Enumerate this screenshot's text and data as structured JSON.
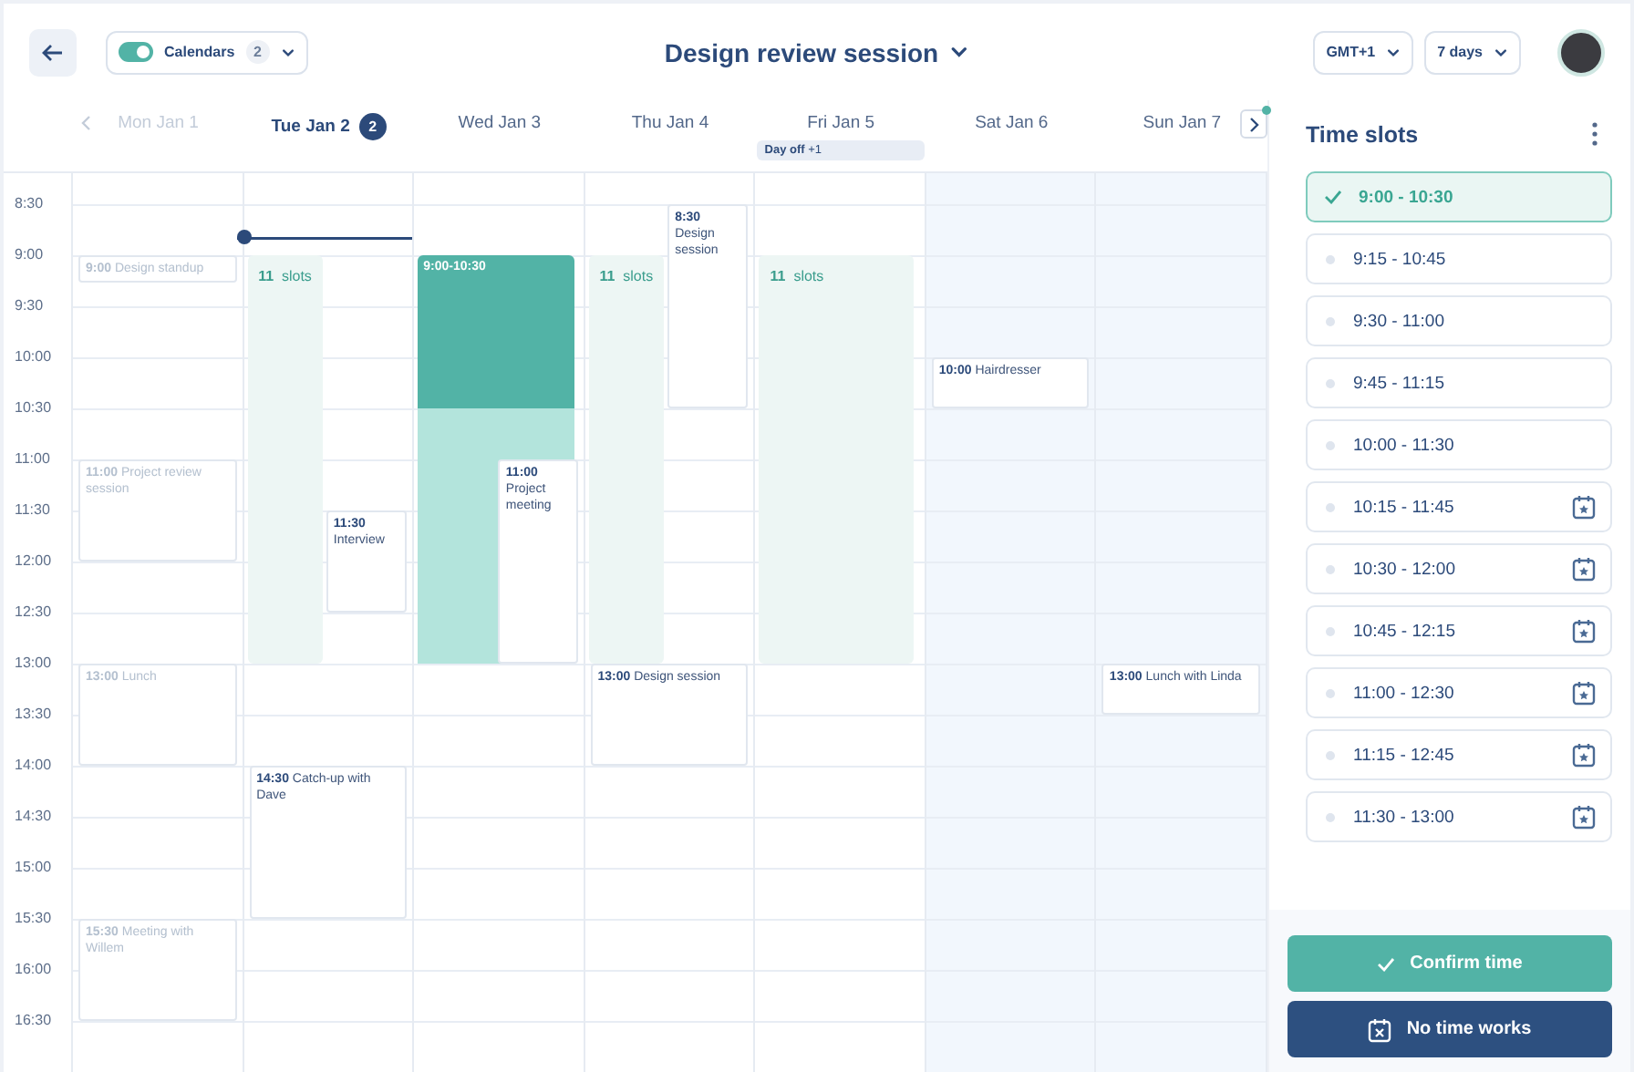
{
  "header": {
    "calendars": {
      "label": "Calendars",
      "count": "2",
      "on": true
    },
    "title": "Design review session",
    "timezone": "GMT+1",
    "range": "7 days"
  },
  "days": [
    {
      "label": "Mon Jan 1",
      "past": true,
      "selected": false,
      "weekend": false,
      "events": [
        {
          "kind": "event",
          "time": "9:00",
          "title": "Design standup"
        },
        {
          "kind": "event",
          "time": "11:00",
          "title": "Project review session"
        },
        {
          "kind": "event",
          "time": "13:00",
          "title": "Lunch"
        },
        {
          "kind": "event",
          "time": "15:30",
          "title": "Meeting with Willem"
        }
      ]
    },
    {
      "label": "Tue Jan 2",
      "badge": "2",
      "past": false,
      "selected": true,
      "weekend": false,
      "events": [
        {
          "kind": "slots",
          "count": "11",
          "label": "slots"
        },
        {
          "kind": "event",
          "time": "11:30",
          "title": "Interview"
        },
        {
          "kind": "event",
          "time": "14:30",
          "title": "Catch-up with Dave"
        }
      ]
    },
    {
      "label": "Wed Jan 3",
      "past": false,
      "selected": false,
      "weekend": false,
      "events": [
        {
          "kind": "selection",
          "label": "9:00-10:30"
        },
        {
          "kind": "event",
          "time": "11:00",
          "title": "Project meeting"
        }
      ]
    },
    {
      "label": "Thu Jan 4",
      "past": false,
      "selected": false,
      "weekend": false,
      "events": [
        {
          "kind": "slots",
          "count": "11",
          "label": "slots"
        },
        {
          "kind": "event",
          "time": "8:30",
          "title": "Design session"
        },
        {
          "kind": "event",
          "time": "13:00",
          "title": "Design session"
        }
      ]
    },
    {
      "label": "Fri Jan 5",
      "chip": {
        "label": "Day off",
        "extra": "+1"
      },
      "past": false,
      "selected": false,
      "weekend": false,
      "events": [
        {
          "kind": "slots",
          "count": "11",
          "label": "slots"
        }
      ]
    },
    {
      "label": "Sat Jan 6",
      "past": false,
      "selected": false,
      "weekend": true,
      "events": [
        {
          "kind": "event",
          "time": "10:00",
          "title": "Hairdresser"
        }
      ]
    },
    {
      "label": "Sun Jan 7",
      "past": false,
      "selected": false,
      "weekend": true,
      "events": [
        {
          "kind": "event",
          "time": "13:00",
          "title": "Lunch with Linda"
        }
      ]
    }
  ],
  "times": [
    "8:30",
    "9:00",
    "9:30",
    "10:00",
    "10:30",
    "11:00",
    "11:30",
    "12:00",
    "12:30",
    "13:00",
    "13:30",
    "14:00",
    "14:30",
    "15:00",
    "15:30",
    "16:00",
    "16:30"
  ],
  "time_slots": {
    "title": "Time slots",
    "items": [
      {
        "label": "9:00 - 10:30",
        "selected": true,
        "starred": false
      },
      {
        "label": "9:15 - 10:45",
        "selected": false,
        "starred": false
      },
      {
        "label": "9:30 - 11:00",
        "selected": false,
        "starred": false
      },
      {
        "label": "9:45 - 11:15",
        "selected": false,
        "starred": false
      },
      {
        "label": "10:00 - 11:30",
        "selected": false,
        "starred": false
      },
      {
        "label": "10:15 - 11:45",
        "selected": false,
        "starred": true
      },
      {
        "label": "10:30 - 12:00",
        "selected": false,
        "starred": true
      },
      {
        "label": "10:45 - 12:15",
        "selected": false,
        "starred": true
      },
      {
        "label": "11:00 - 12:30",
        "selected": false,
        "starred": true
      },
      {
        "label": "11:15 - 12:45",
        "selected": false,
        "starred": true
      },
      {
        "label": "11:30 - 13:00",
        "selected": false,
        "starred": true
      }
    ]
  },
  "actions": [
    {
      "kind": "confirm",
      "label": "Confirm time"
    },
    {
      "kind": "decline",
      "label": "No time works"
    }
  ]
}
